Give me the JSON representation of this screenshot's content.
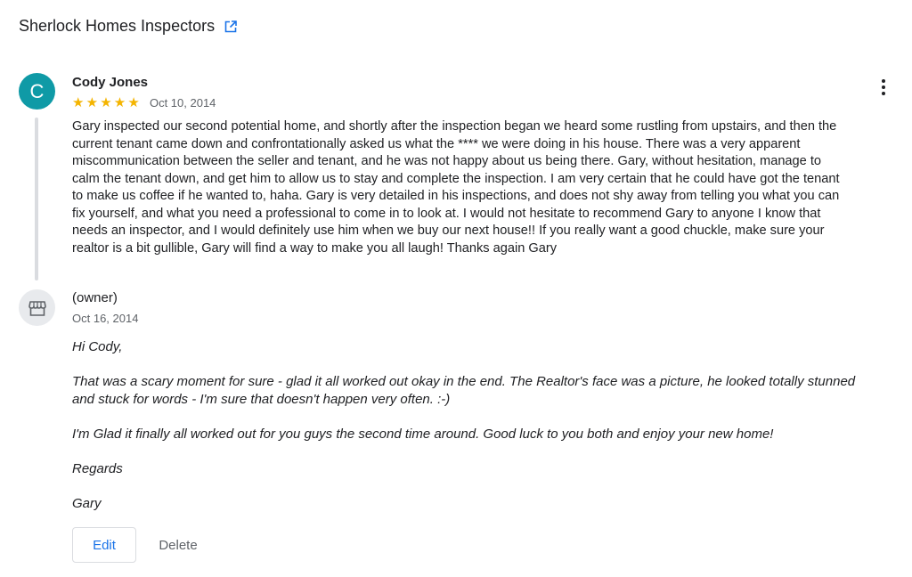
{
  "business": {
    "name": "Sherlock Homes Inspectors",
    "link_icon": "open-in-new-icon"
  },
  "review": {
    "avatar_letter": "C",
    "avatar_color": "#0f9aa6",
    "author": "Cody Jones",
    "rating": 5,
    "stars": "★★★★★",
    "date": "Oct 10, 2014",
    "more_icon": "more-vert-icon",
    "text": "Gary inspected our second potential home, and shortly after the inspection began we heard some rustling from upstairs, and then the current tenant came down and confrontationally asked us what the **** we were doing in his house. There was a very apparent miscommunication between the seller and tenant, and he was not happy about us being there. Gary, without hesitation, manage to calm the tenant down, and get him to allow us to stay and complete the inspection. I am very certain that he could have got the tenant to make us coffee if he wanted to, haha. Gary is very detailed in his inspections, and does not shy away from telling you what you can fix yourself, and what you need a professional to come in to look at. I would not hesitate to recommend Gary to anyone I know that needs an inspector, and I would definitely use him when we buy our next house!! If you really want a good chuckle, make sure your realtor is a bit gullible, Gary will find a way to make you all laugh! Thanks again Gary"
  },
  "owner_reply": {
    "avatar_icon": "storefront-icon",
    "label": "(owner)",
    "date": "Oct 16, 2014",
    "paragraphs": [
      "Hi Cody,",
      "That was a scary moment for sure - glad it all worked out okay in the end. The Realtor's face was a picture, he looked totally stunned and stuck for words - I'm sure that doesn't happen very often. :-)",
      "I'm Glad it finally all worked out for you guys the second time around. Good luck to you both and enjoy your new home!",
      "Regards",
      "Gary"
    ]
  },
  "actions": {
    "edit_label": "Edit",
    "delete_label": "Delete"
  },
  "colors": {
    "accent": "#1a73e8",
    "star": "#f4b400",
    "secondary_text": "#5f6368"
  }
}
